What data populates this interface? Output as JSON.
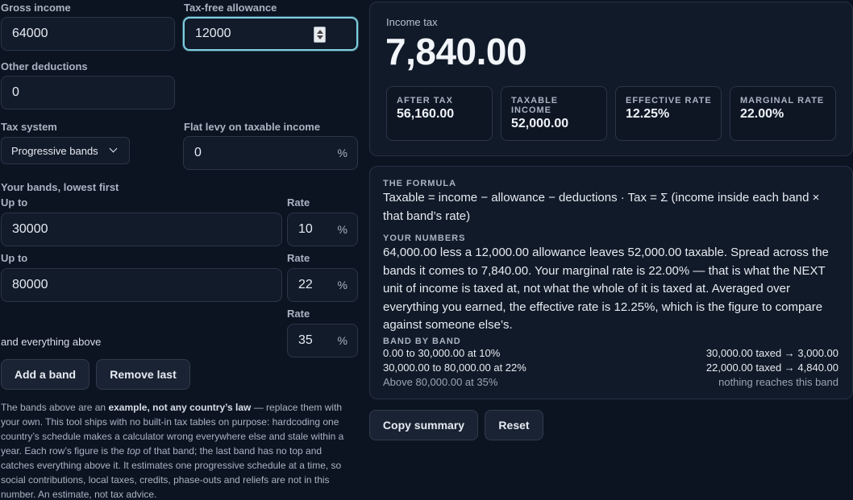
{
  "inputs": {
    "gross_income_label": "Gross income",
    "gross_income_value": "64000",
    "allowance_label": "Tax-free allowance",
    "allowance_value": "12000",
    "deductions_label": "Other deductions",
    "deductions_value": "0",
    "tax_system_label": "Tax system",
    "tax_system_value": "Progressive bands",
    "flat_levy_label": "Flat levy on taxable income",
    "flat_levy_value": "0",
    "percent": "%"
  },
  "bands": {
    "heading": "Your bands, lowest first",
    "up_to_label": "Up to",
    "rate_label": "Rate",
    "rows": [
      {
        "up_to": "30000",
        "rate": "10"
      },
      {
        "up_to": "80000",
        "rate": "22"
      }
    ],
    "above_label": "and everything above",
    "above_rate": "35",
    "add_button": "Add a band",
    "remove_button": "Remove last"
  },
  "note": {
    "t1": "The bands above are an ",
    "b1": "example, not any country’s law",
    "t2": " — replace them with your own. This tool ships with no built-in tax tables on purpose: hardcoding one country’s schedule makes a calculator wrong everywhere else and stale within a year. Each row’s figure is the ",
    "i1": "top",
    "t3": " of that band; the last band has no top and catches everything above it. It estimates one progressive schedule at a time, so social contributions, local taxes, credits, phase-outs and reliefs are not in this number. An estimate, not tax advice."
  },
  "result": {
    "label": "Income tax",
    "value": "7,840.00",
    "stats": [
      {
        "label": "AFTER TAX",
        "value": "56,160.00"
      },
      {
        "label": "TAXABLE INCOME",
        "value": "52,000.00"
      },
      {
        "label": "EFFECTIVE RATE",
        "value": "12.25%"
      },
      {
        "label": "MARGINAL RATE",
        "value": "22.00%"
      }
    ]
  },
  "explain": {
    "formula_heading": "THE FORMULA",
    "formula": "Taxable = income − allowance − deductions · Tax = Σ (income inside each band × that band’s rate)",
    "numbers_heading": "YOUR NUMBERS",
    "numbers": "64,000.00 less a 12,000.00 allowance leaves 52,000.00 taxable. Spread across the bands it comes to 7,840.00. Your marginal rate is 22.00% — that is what the NEXT unit of income is taxed at, not what the whole of it is taxed at. Averaged over everything you earned, the effective rate is 12.25%, which is the figure to compare against someone else’s.",
    "band_heading": "BAND BY BAND",
    "band_rows": [
      {
        "left": "0.00 to 30,000.00 at 10%",
        "right": "30,000.00 taxed → 3,000.00"
      },
      {
        "left": "30,000.00 to 80,000.00 at 22%",
        "right": "22,000.00 taxed → 4,840.00"
      },
      {
        "left": "Above 80,000.00 at 35%",
        "right": "nothing reaches this band"
      }
    ]
  },
  "actions": {
    "copy": "Copy summary",
    "reset": "Reset"
  }
}
